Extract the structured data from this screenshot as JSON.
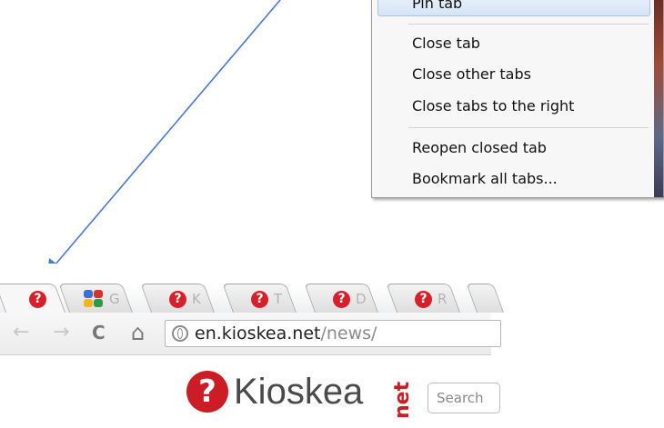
{
  "context_menu": {
    "items": [
      {
        "label": "Pin tab",
        "highlighted": true
      },
      {
        "label": "Close tab"
      },
      {
        "label": "Close other tabs"
      },
      {
        "label": "Close tabs to the right"
      },
      {
        "label": "Reopen closed tab"
      },
      {
        "label": "Bookmark all tabs..."
      }
    ]
  },
  "tabs": [
    {
      "favicon": "kioskea-icon",
      "title": "",
      "active": true
    },
    {
      "favicon": "google-icon",
      "title": "G"
    },
    {
      "favicon": "kioskea-icon",
      "title": "K"
    },
    {
      "favicon": "kioskea-icon",
      "title": "T"
    },
    {
      "favicon": "kioskea-icon",
      "title": "D"
    },
    {
      "favicon": "kioskea-icon",
      "title": "R"
    }
  ],
  "toolbar": {
    "back": "←",
    "forward": "→",
    "reload": "C",
    "home": "⌂",
    "url_host": "en.kioskea.net",
    "url_path": "/news/"
  },
  "page": {
    "logo_mark": "?",
    "logo_text": "Kioskea",
    "logo_net": "net",
    "search_placeholder": "Search"
  },
  "colors": {
    "brand_red": "#d6202b",
    "arrow": "#3f6fd0"
  }
}
